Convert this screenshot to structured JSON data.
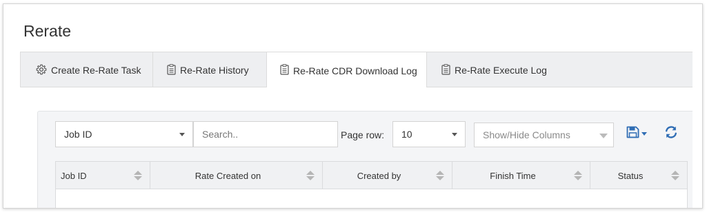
{
  "page": {
    "title": "Rerate"
  },
  "tabs": [
    {
      "label": "Create Re-Rate Task",
      "icon": "gear-icon",
      "active": false
    },
    {
      "label": "Re-Rate History",
      "icon": "clipboard-icon",
      "active": false
    },
    {
      "label": "Re-Rate CDR Download Log",
      "icon": "clipboard-icon",
      "active": true
    },
    {
      "label": "Re-Rate Execute Log",
      "icon": "clipboard-icon",
      "active": false
    }
  ],
  "toolbar": {
    "search_field": {
      "selected": "Job ID"
    },
    "search": {
      "placeholder": "Search.."
    },
    "page_row": {
      "label": "Page row:",
      "selected": "10"
    },
    "columns": {
      "placeholder": "Show/Hide Columns"
    },
    "save_icon": "floppy-disk-icon",
    "refresh_icon": "refresh-icon"
  },
  "colors": {
    "accent": "#2f6db4",
    "tab_bg": "#eeeff1",
    "panel_bg": "#f4f5f7"
  },
  "table": {
    "columns": [
      "Job ID",
      "Rate Created on",
      "Created by",
      "Finish Time",
      "Status"
    ]
  }
}
